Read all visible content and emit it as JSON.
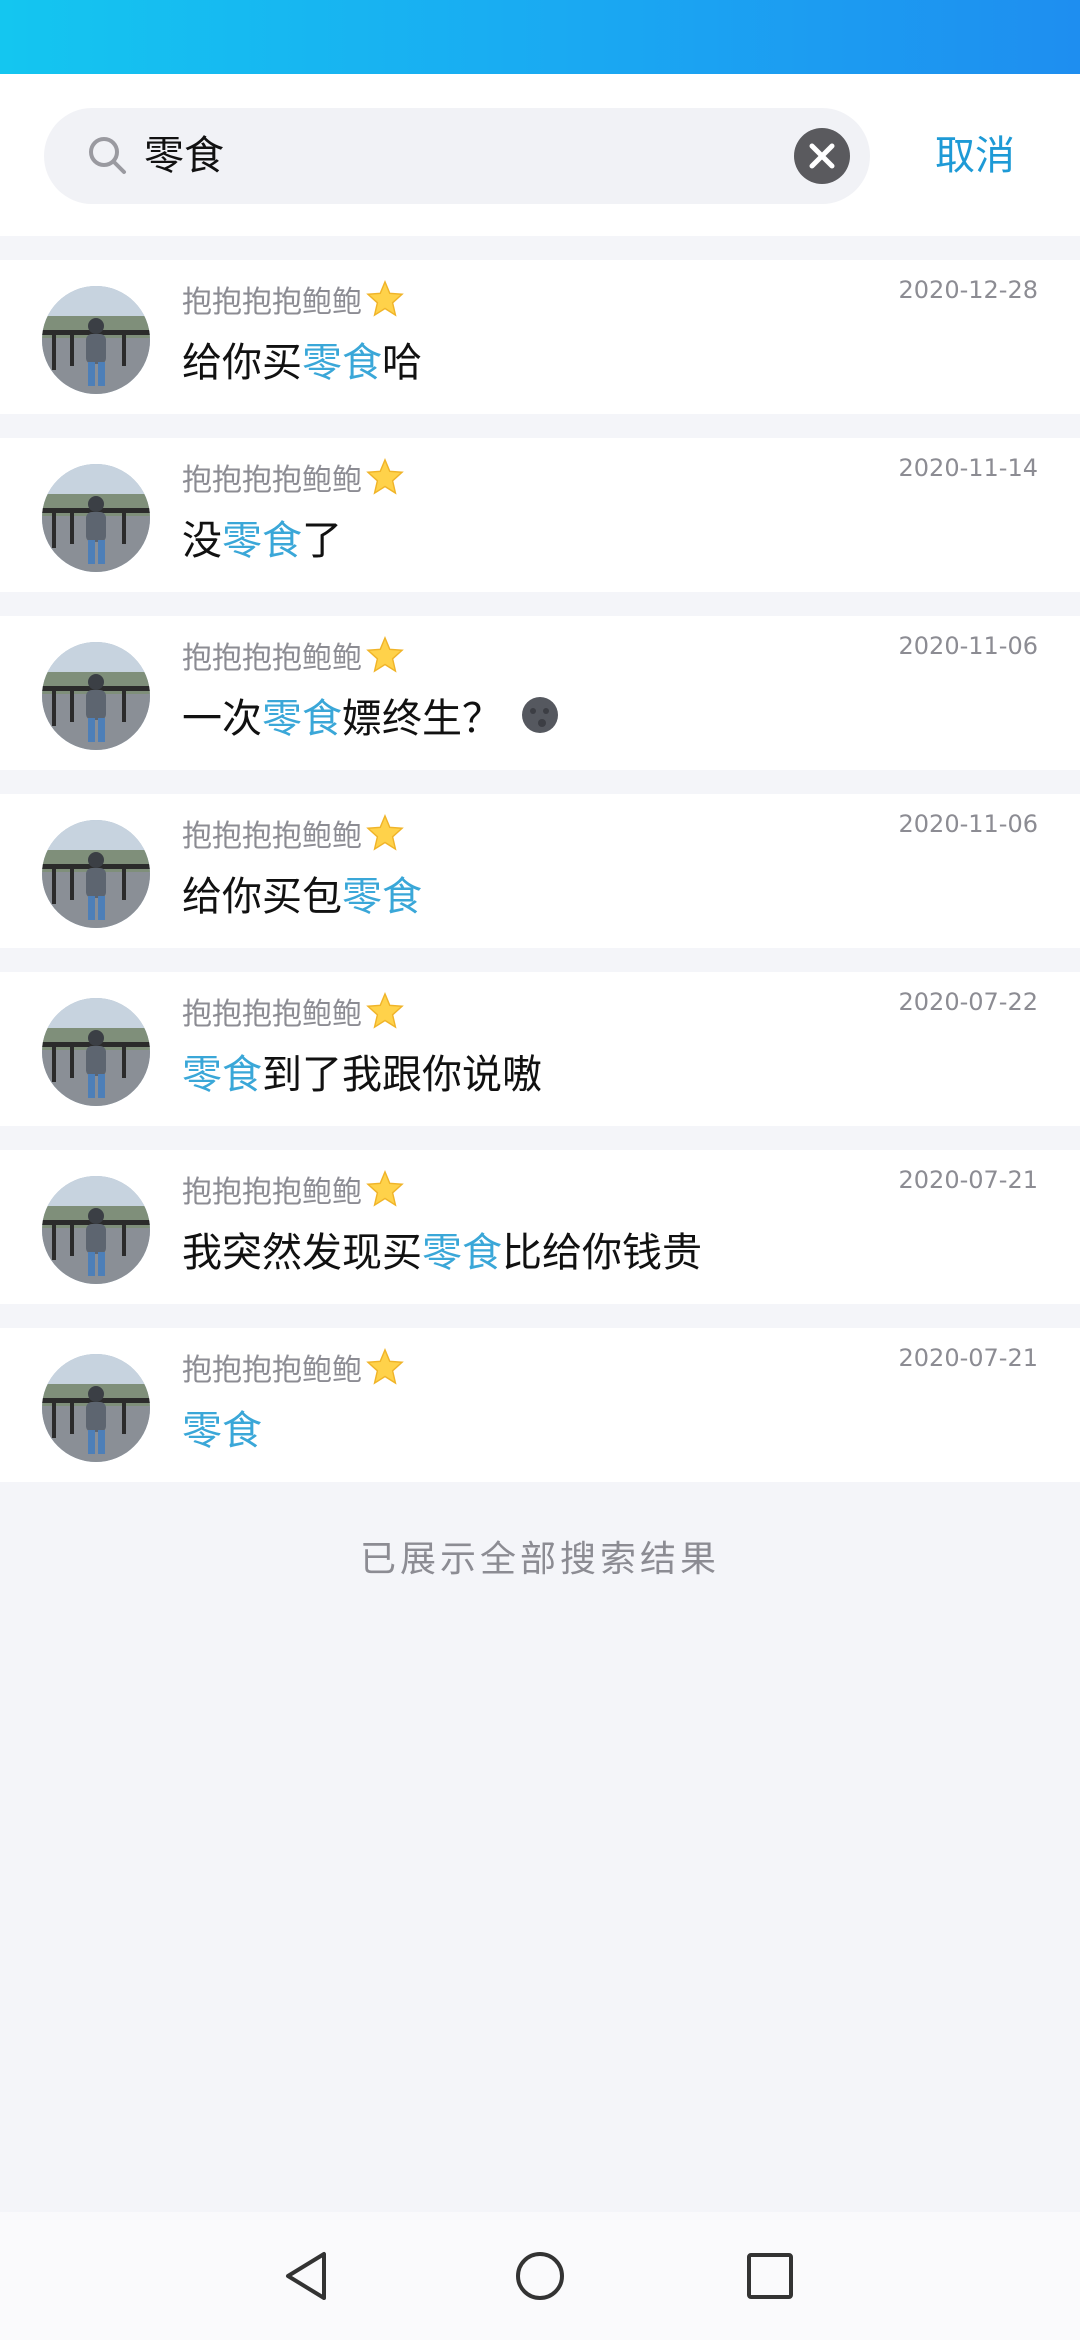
{
  "search": {
    "query": "零食",
    "cancel_label": "取消"
  },
  "results": [
    {
      "name": "抱抱抱抱鲍鲍",
      "date": "2020-12-28",
      "before": "给你买",
      "match": "零食",
      "after": "哈",
      "emoji": ""
    },
    {
      "name": "抱抱抱抱鲍鲍",
      "date": "2020-11-14",
      "before": "没",
      "match": "零食",
      "after": "了",
      "emoji": ""
    },
    {
      "name": "抱抱抱抱鲍鲍",
      "date": "2020-11-06",
      "before": "一次",
      "match": "零食",
      "after": "嫖终生？",
      "emoji": "moon-icon"
    },
    {
      "name": "抱抱抱抱鲍鲍",
      "date": "2020-11-06",
      "before": "给你买包",
      "match": "零食",
      "after": "",
      "emoji": ""
    },
    {
      "name": "抱抱抱抱鲍鲍",
      "date": "2020-07-22",
      "before": "",
      "match": "零食",
      "after": "到了我跟你说嗷",
      "emoji": ""
    },
    {
      "name": "抱抱抱抱鲍鲍",
      "date": "2020-07-21",
      "before": "我突然发现买",
      "match": "零食",
      "after": "比给你钱贵",
      "emoji": ""
    },
    {
      "name": "抱抱抱抱鲍鲍",
      "date": "2020-07-21",
      "before": "",
      "match": "零食",
      "after": "",
      "emoji": ""
    }
  ],
  "footer_note": "已展示全部搜索结果",
  "colors": {
    "accent": "#1e9ad6",
    "highlight": "#3aa7d8",
    "status_gradient_start": "#14c6f0",
    "status_gradient_end": "#1e8ef0"
  }
}
